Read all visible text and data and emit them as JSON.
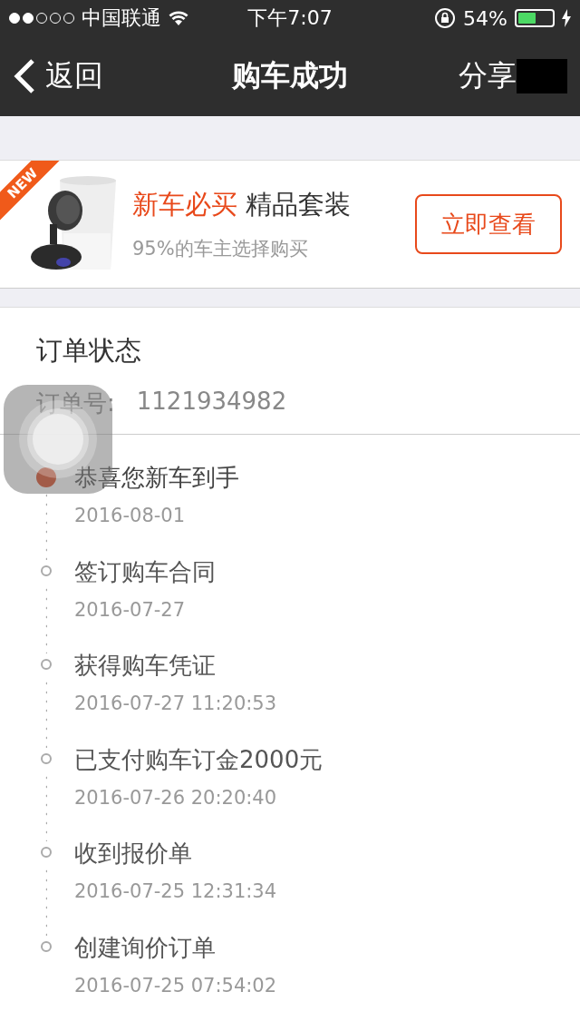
{
  "status_bar": {
    "carrier": "中国联通",
    "time": "下午7:07",
    "battery_percent": "54%"
  },
  "nav_bar": {
    "back": "返回",
    "title": "购车成功",
    "share": "分享"
  },
  "banner": {
    "ribbon": "NEW",
    "headline_highlight": "新车必买",
    "headline": "精品套装",
    "subtitle": "95%的车主选择购买",
    "button": "立即查看"
  },
  "order": {
    "title": "订单状态",
    "number_label": "订单号:",
    "number": "1121934982"
  },
  "timeline": [
    {
      "title": "恭喜您新车到手",
      "date": "2016-08-01",
      "current": true
    },
    {
      "title": "签订购车合同",
      "date": "2016-07-27",
      "current": false
    },
    {
      "title": "获得购车凭证",
      "date": "2016-07-27 11:20:53",
      "current": false
    },
    {
      "title": "已支付购车订金2000元",
      "date": "2016-07-26 20:20:40",
      "current": false
    },
    {
      "title": "收到报价单",
      "date": "2016-07-25 12:31:34",
      "current": false
    },
    {
      "title": "创建询价订单",
      "date": "2016-07-25 07:54:02",
      "current": false
    }
  ]
}
